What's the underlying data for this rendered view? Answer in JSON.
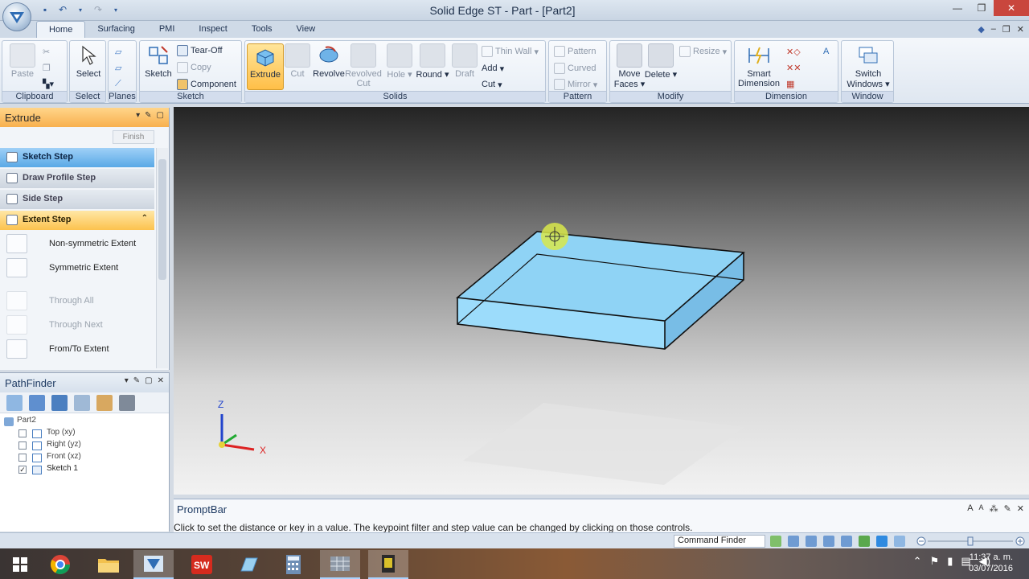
{
  "window": {
    "title": "Solid Edge ST - Part - [Part2]",
    "controls": [
      "—",
      "❐",
      "✕"
    ]
  },
  "ribbon": {
    "tabs": [
      "Home",
      "Surfacing",
      "PMI",
      "Inspect",
      "Tools",
      "View"
    ],
    "active_tab": "Home",
    "groups": {
      "clipboard": {
        "label": "Clipboard",
        "paste": "Paste"
      },
      "select": {
        "label": "Select",
        "select": "Select"
      },
      "planes": {
        "label": "Planes"
      },
      "sketch": {
        "label": "Sketch",
        "sketch": "Sketch",
        "tear_off": "Tear-Off",
        "copy": "Copy",
        "component": "Component"
      },
      "solids": {
        "label": "Solids",
        "extrude": "Extrude",
        "cut": "Cut",
        "revolve": "Revolve",
        "revolved_cut_1": "Revolved",
        "revolved_cut_2": "Cut",
        "hole": "Hole",
        "round": "Round",
        "draft": "Draft",
        "thin_wall": "Thin Wall",
        "add": "Add",
        "cut_menu": "Cut"
      },
      "pattern": {
        "label": "Pattern",
        "pattern": "Pattern",
        "curved": "Curved",
        "mirror": "Mirror"
      },
      "modify": {
        "label": "Modify",
        "move_faces_1": "Move",
        "move_faces_2": "Faces",
        "delete": "Delete",
        "resize": "Resize"
      },
      "dimension": {
        "label": "Dimension",
        "smart_dim_1": "Smart",
        "smart_dim_2": "Dimension"
      },
      "window": {
        "label": "Window",
        "switch_1": "Switch",
        "switch_2": "Windows"
      }
    }
  },
  "extrude_panel": {
    "title": "Extrude",
    "finish": "Finish",
    "steps": [
      "Sketch Step",
      "Draw Profile Step",
      "Side Step",
      "Extent Step"
    ],
    "options": [
      "Non-symmetric Extent",
      "Symmetric Extent",
      "Through All",
      "Through Next",
      "From/To Extent"
    ]
  },
  "pathfinder": {
    "title": "PathFinder",
    "root": "Part2",
    "items": [
      {
        "label": "Top (xy)",
        "checked": false
      },
      {
        "label": "Right (yz)",
        "checked": false
      },
      {
        "label": "Front (xz)",
        "checked": false
      },
      {
        "label": "Sketch 1",
        "checked": true
      }
    ]
  },
  "viewport": {
    "axis_labels": {
      "z": "Z",
      "x": "X"
    }
  },
  "promptbar": {
    "title": "PromptBar",
    "text": "Click to set the distance or key in a value. The keypoint filter and step value can be changed by clicking on those controls."
  },
  "statusbar": {
    "command_finder": "Command Finder"
  },
  "taskbar": {
    "time": "11:37 a. m.",
    "date": "03/07/2016"
  },
  "colors": {
    "accent_orange": "#f8b04e",
    "selected_blue": "#5aa9e6",
    "solid_body": "#8fd3f5"
  }
}
